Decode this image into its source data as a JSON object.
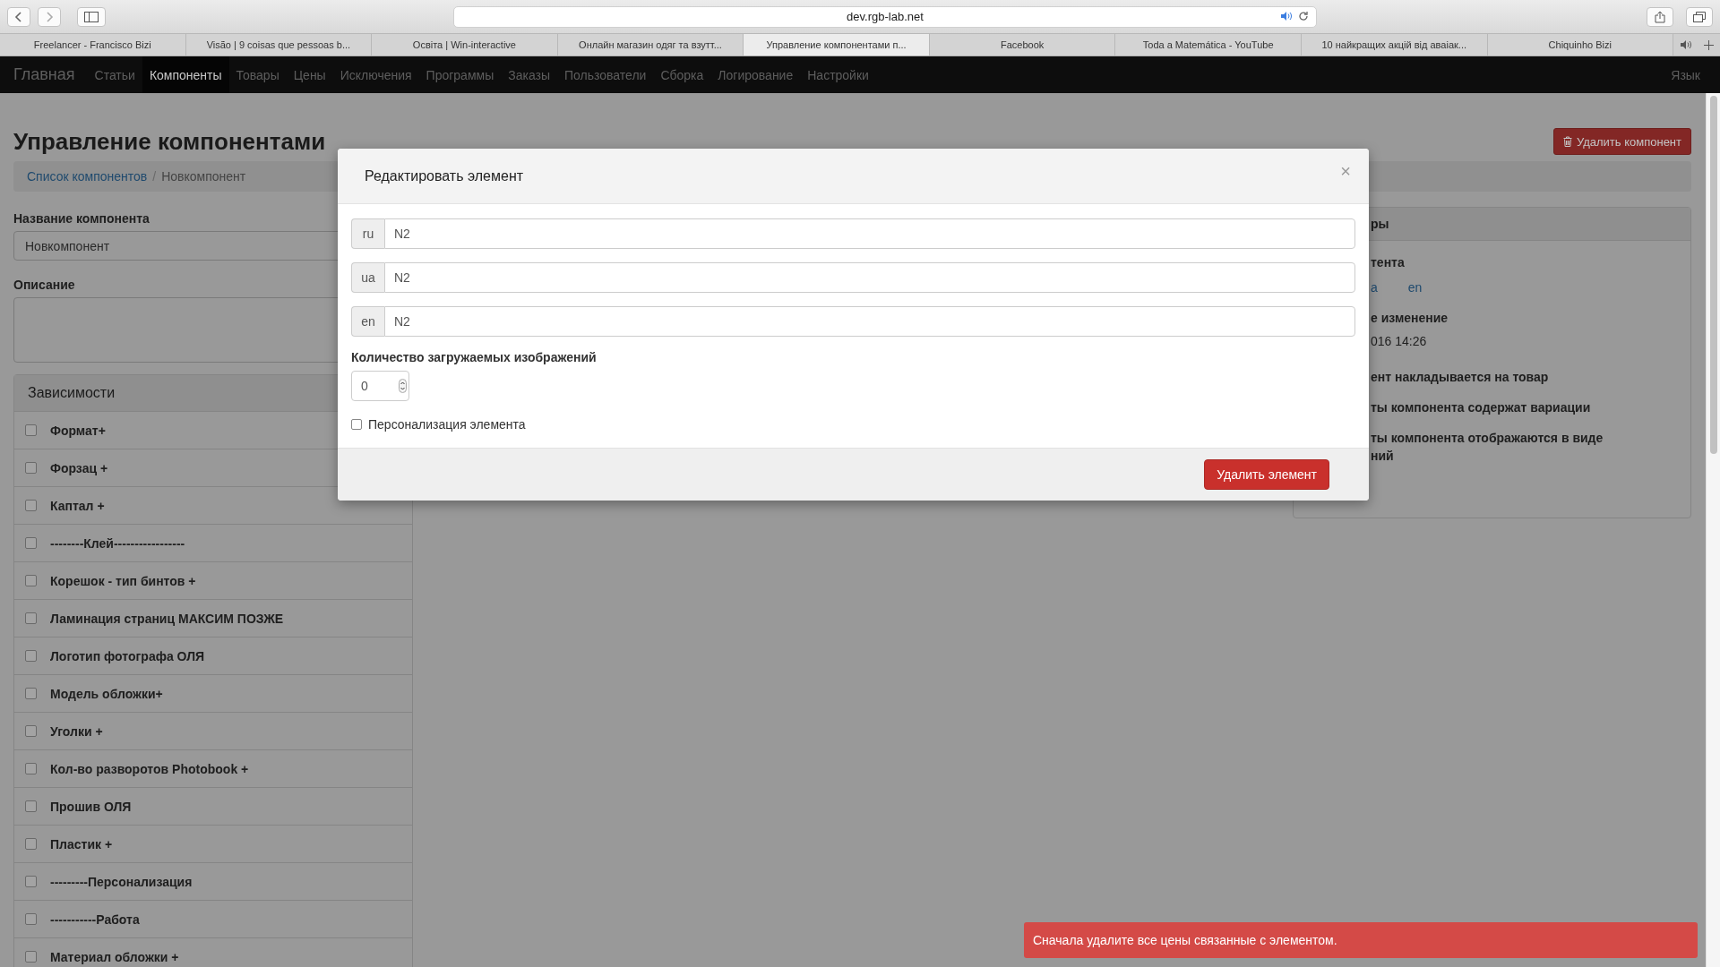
{
  "browser": {
    "url": "dev.rgb-lab.net",
    "tabs": [
      {
        "title": "Freelancer - Francisco Bizi",
        "selected": false
      },
      {
        "title": "Visão | 9 coisas que pessoas b...",
        "selected": false
      },
      {
        "title": "Освіта | Win-interactive",
        "selected": false
      },
      {
        "title": "Онлайн магазин одяг та взутт...",
        "selected": false
      },
      {
        "title": "Управление компонентами п...",
        "selected": true
      },
      {
        "title": "Facebook",
        "selected": false
      },
      {
        "title": "Toda a Matemática - YouTube",
        "selected": false
      },
      {
        "title": "10 найкращих акцій від аваіак...",
        "selected": false
      },
      {
        "title": "Chiquinho Bizi",
        "selected": false
      }
    ]
  },
  "navbar": {
    "brand": "Главная",
    "items": [
      {
        "label": "Статьи",
        "selected": false
      },
      {
        "label": "Компоненты",
        "selected": true
      },
      {
        "label": "Товары",
        "selected": false
      },
      {
        "label": "Цены",
        "selected": false
      },
      {
        "label": "Исключения",
        "selected": false
      },
      {
        "label": "Программы",
        "selected": false
      },
      {
        "label": "Заказы",
        "selected": false
      },
      {
        "label": "Пользователи",
        "selected": false
      },
      {
        "label": "Сборка",
        "selected": false
      },
      {
        "label": "Логирование",
        "selected": false
      },
      {
        "label": "Настройки",
        "selected": false
      }
    ],
    "language": "Язык"
  },
  "page": {
    "title": "Управление компонентами",
    "delete_button": "Удалить компонент",
    "breadcrumb": [
      {
        "label": "Список компонентов",
        "kind": "link"
      },
      {
        "label": "/",
        "kind": "separator"
      },
      {
        "label": "Новкомпонент",
        "kind": "current"
      }
    ],
    "name_label": "Название компонента",
    "name_value": "Новкомпонент",
    "description_label": "Описание",
    "dependencies": {
      "title": "Зависимости",
      "items": [
        {
          "label": "Формат+",
          "checked": false
        },
        {
          "label": "Форзац +",
          "checked": false
        },
        {
          "label": "Каптал +",
          "checked": false
        },
        {
          "label": "--------Клей-----------------",
          "checked": false
        },
        {
          "label": "Корешок - тип бинтов +",
          "checked": false
        },
        {
          "label": "Ламинация страниц МАКСИМ ПОЗЖЕ",
          "checked": false
        },
        {
          "label": "Логотип фотографа ОЛЯ",
          "checked": false
        },
        {
          "label": "Модель обложки+",
          "checked": false
        },
        {
          "label": "Уголки +",
          "checked": false
        },
        {
          "label": "Кол-во разворотов Photobook +",
          "checked": false
        },
        {
          "label": "Прошив ОЛЯ",
          "checked": false
        },
        {
          "label": "Пластик +",
          "checked": false
        },
        {
          "label": "---------Персонализация",
          "checked": false
        },
        {
          "label": "-----------Работа",
          "checked": false
        },
        {
          "label": "Материал обложки +",
          "checked": false
        }
      ]
    }
  },
  "right_panel": {
    "title": "ры",
    "lines": [
      {
        "kind": "heading",
        "text": "тента"
      },
      {
        "kind": "links",
        "links": [
          "a",
          "en"
        ]
      },
      {
        "kind": "heading",
        "text": "е изменение"
      },
      {
        "kind": "text",
        "text": "016 14:26"
      },
      {
        "kind": "heading",
        "text": "ент накладывается на товар"
      },
      {
        "kind": "heading",
        "text": "ты компонента содержат вариации"
      },
      {
        "kind": "heading",
        "text": "ты компонента отображаются в виде\nний"
      }
    ]
  },
  "modal": {
    "title": "Редактировать элемент",
    "close": "×",
    "translations": [
      {
        "lang": "ru",
        "value": "N2"
      },
      {
        "lang": "ua",
        "value": "N2"
      },
      {
        "lang": "en",
        "value": "N2"
      }
    ],
    "count_label": "Количество загружаемых изображений",
    "count_value": "0",
    "personalization": {
      "label": "Персонализация элемента",
      "checked": false
    },
    "delete_button": "Удалить элемент"
  },
  "toast": {
    "message": "Сначала удалите все цены связанные с элементом."
  }
}
